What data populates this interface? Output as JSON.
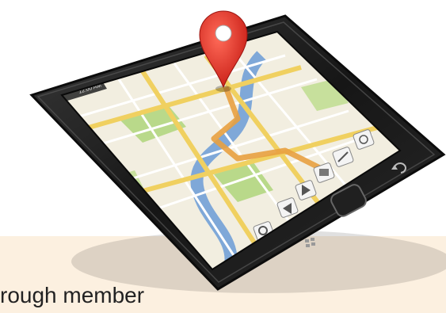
{
  "colors": {
    "band": "#fcf0e0",
    "phone_body": "#1b1b1b",
    "phone_bezel": "#2e2e2e",
    "map_bg": "#f2eee0",
    "road_major": "#f0d060",
    "road_minor": "#ffffff",
    "park": "#b9d98a",
    "water": "#7fa8d8",
    "route": "#e8a040",
    "pin": "#e53028"
  },
  "icons": [
    "map-pin-icon",
    "zoom-icon",
    "pan-left-icon",
    "pan-right-icon",
    "layers-icon",
    "navigation-icon",
    "compass-icon",
    "back-icon",
    "home-button-icon",
    "menu-icon"
  ],
  "status_bar": {
    "time": "12:00 AM"
  },
  "caption": {
    "text": "rough member"
  }
}
